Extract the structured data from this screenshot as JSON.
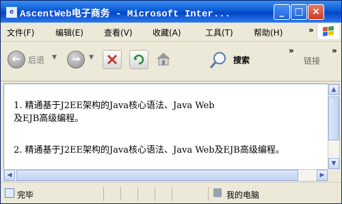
{
  "window": {
    "title": "AscentWeb电子商务 - Microsoft Inter...",
    "minimize_glyph": "_",
    "maximize_glyph": "□",
    "close_glyph": "×"
  },
  "menu": {
    "items": [
      "文件(F)",
      "编辑(E)",
      "查看(V)",
      "收藏(A)",
      "工具(T)",
      "帮助(H)"
    ],
    "overflow": "»"
  },
  "toolbar": {
    "back_label": "后退",
    "search_label": "搜索",
    "overflow": "»",
    "links_label": "链接",
    "icons": [
      "back-icon",
      "forward-icon",
      "stop-icon",
      "refresh-icon",
      "home-icon",
      "search-icon"
    ]
  },
  "content": {
    "paragraph1_line1": "1. 精通基于J2EE架构的Java核心语法、Java Web",
    "paragraph1_line2": "及EJB高级编程。",
    "paragraph2": "2. 精通基于J2EE架构的Java核心语法、Java Web及EJB高级编程。"
  },
  "status": {
    "left": "完毕",
    "zone": "我的电脑"
  },
  "colors": {
    "titlebar": "#0a5ad6",
    "chrome": "#ece9d8",
    "scrollbar": "#c1d3f5"
  }
}
